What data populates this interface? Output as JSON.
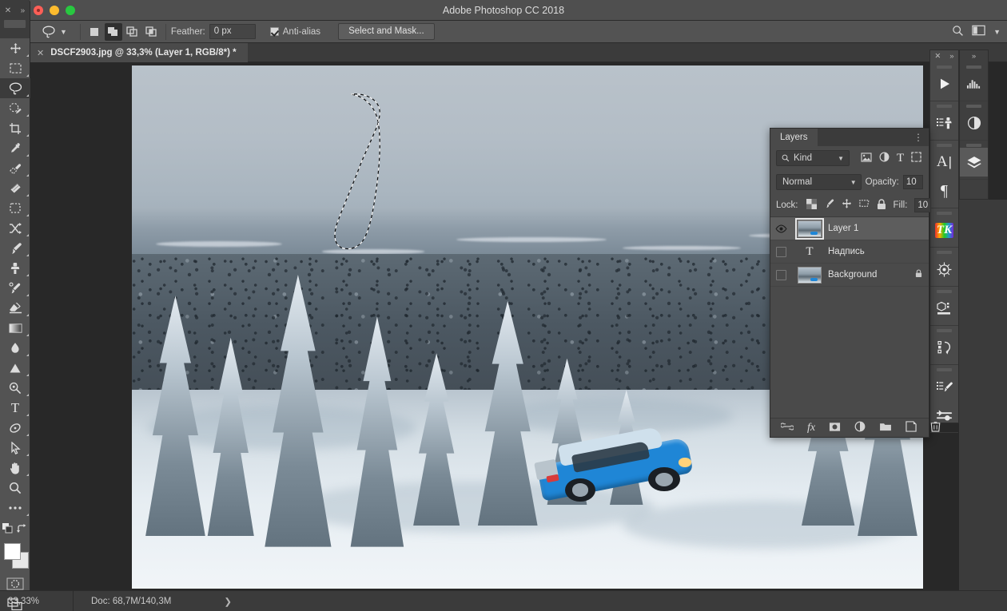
{
  "window": {
    "app_title": "Adobe Photoshop CC 2018",
    "traffic_lights": [
      "close-button",
      "minimize-button",
      "zoom-button"
    ]
  },
  "options_bar": {
    "active_tool_icon": "lasso-tool-icon",
    "tool_preset_chevron": "chevron-down-icon",
    "selection_modes": [
      {
        "name": "new-selection",
        "icon": "square-icon",
        "active": false
      },
      {
        "name": "add-to-selection",
        "icon": "two-squares-union-icon",
        "active": true
      },
      {
        "name": "subtract-from-selection",
        "icon": "two-squares-subtract-icon",
        "active": false
      },
      {
        "name": "intersect-with-selection",
        "icon": "two-squares-intersect-icon",
        "active": false
      }
    ],
    "feather_label": "Feather:",
    "feather_value": "0 px",
    "anti_alias_label": "Anti-alias",
    "anti_alias_checked": true,
    "select_and_mask_label": "Select and Mask...",
    "search_icon": "search-icon",
    "workspace_icon": "workspace-switcher-icon",
    "workspace_chevron": "chevron-down-icon"
  },
  "document_tab": {
    "close_icon": "close-icon",
    "title": "DSCF2903.jpg @ 33,3% (Layer 1, RGB/8*) *"
  },
  "toolbar": {
    "tools": [
      {
        "name": "move-tool",
        "icon": "move-icon",
        "has_flyout": true,
        "active": false
      },
      {
        "name": "rectangular-marquee-tool",
        "icon": "marquee-rect-icon",
        "has_flyout": true,
        "active": false
      },
      {
        "name": "lasso-tool",
        "icon": "lasso-icon",
        "has_flyout": true,
        "active": true
      },
      {
        "name": "quick-selection-tool",
        "icon": "quick-selection-icon",
        "has_flyout": true,
        "active": false
      },
      {
        "name": "crop-tool",
        "icon": "crop-icon",
        "has_flyout": true,
        "active": false
      },
      {
        "name": "eyedropper-tool",
        "icon": "eyedropper-icon",
        "has_flyout": true,
        "active": false
      },
      {
        "name": "spot-healing-brush-tool",
        "icon": "healing-brush-icon",
        "has_flyout": true,
        "active": false
      },
      {
        "name": "patch-tool",
        "icon": "patch-icon",
        "has_flyout": true,
        "active": false
      },
      {
        "name": "frame-tool",
        "icon": "frame-icon",
        "has_flyout": true,
        "active": false
      },
      {
        "name": "shuffle-tool",
        "icon": "shuffle-icon",
        "has_flyout": true,
        "active": false
      },
      {
        "name": "brush-tool",
        "icon": "brush-icon",
        "has_flyout": true,
        "active": false
      },
      {
        "name": "clone-stamp-tool",
        "icon": "clone-stamp-icon",
        "has_flyout": true,
        "active": false
      },
      {
        "name": "history-brush-tool",
        "icon": "history-brush-icon",
        "has_flyout": true,
        "active": false
      },
      {
        "name": "eraser-tool",
        "icon": "eraser-icon",
        "has_flyout": true,
        "active": false
      },
      {
        "name": "gradient-tool",
        "icon": "gradient-icon",
        "has_flyout": true,
        "active": false
      },
      {
        "name": "blur-tool",
        "icon": "blur-droplet-icon",
        "has_flyout": true,
        "active": false
      },
      {
        "name": "dodge-tool",
        "icon": "dodge-triangle-icon",
        "has_flyout": true,
        "active": false
      },
      {
        "name": "pen-tool",
        "icon": "pen-icon",
        "has_flyout": true,
        "active": false
      },
      {
        "name": "type-tool",
        "icon": "type-T-icon",
        "has_flyout": true,
        "active": false
      },
      {
        "name": "path-selection-tool",
        "icon": "path-selection-icon",
        "has_flyout": true,
        "active": false
      },
      {
        "name": "direct-selection-tool",
        "icon": "arrow-cursor-icon",
        "has_flyout": true,
        "active": false
      },
      {
        "name": "hand-tool",
        "icon": "hand-icon",
        "has_flyout": true,
        "active": false
      },
      {
        "name": "zoom-tool",
        "icon": "magnifier-icon",
        "has_flyout": false,
        "active": false
      },
      {
        "name": "edit-toolbar",
        "icon": "ellipsis-icon",
        "has_flyout": true,
        "active": false
      }
    ],
    "default_colors_icon": "default-colors-icon",
    "swap_colors_icon": "swap-colors-icon",
    "foreground_color": "#ffffff",
    "background_color": "#e8e8e8",
    "quick_mask_icon": "quick-mask-icon",
    "screen_mode_icon": "screen-mode-icon"
  },
  "mini_dock": {
    "close_icon": "close-icon",
    "expand_icon": "double-chevron-icon"
  },
  "layers_panel": {
    "tab_label": "Layers",
    "menu_icon": "panel-menu-icon",
    "filter": {
      "search_icon": "search-icon",
      "kind_label": "Kind",
      "chevron": "chevron-down-icon",
      "filter_icons": [
        {
          "name": "filter-pixel-layers-icon"
        },
        {
          "name": "filter-adjustment-layers-icon"
        },
        {
          "name": "filter-type-layers-icon"
        },
        {
          "name": "filter-shape-layers-icon"
        }
      ]
    },
    "blend_mode": "Normal",
    "blend_chevron": "chevron-down-icon",
    "opacity_label": "Opacity:",
    "opacity_value": "10",
    "lock_label": "Lock:",
    "lock_icons": [
      {
        "name": "lock-transparent-pixels-icon"
      },
      {
        "name": "lock-image-pixels-icon"
      },
      {
        "name": "lock-position-icon"
      },
      {
        "name": "lock-artboard-nesting-icon"
      },
      {
        "name": "lock-all-icon"
      }
    ],
    "fill_label": "Fill:",
    "fill_value": "10",
    "layers": [
      {
        "name": "Layer 1",
        "visible": true,
        "selected": true,
        "kind": "pixel",
        "locked": false
      },
      {
        "name": "Надпись",
        "visible": false,
        "selected": false,
        "kind": "type",
        "locked": false
      },
      {
        "name": "Background",
        "visible": false,
        "selected": false,
        "kind": "pixel",
        "locked": true
      }
    ],
    "bottom_buttons": [
      {
        "name": "link-layers-button",
        "icon": "link-icon"
      },
      {
        "name": "layer-style-button",
        "icon": "fx-icon"
      },
      {
        "name": "add-layer-mask-button",
        "icon": "layer-mask-icon"
      },
      {
        "name": "new-adjustment-layer-button",
        "icon": "adjustment-circle-icon"
      },
      {
        "name": "new-group-button",
        "icon": "folder-icon"
      },
      {
        "name": "new-layer-button",
        "icon": "new-layer-icon"
      },
      {
        "name": "delete-layer-button",
        "icon": "trash-icon"
      }
    ]
  },
  "icon_dock_primary": {
    "close_icon": "close-icon",
    "expand_icon": "double-chevron-icon",
    "items": [
      {
        "name": "actions-panel-icon",
        "glyph": "play-triangle-icon"
      },
      {
        "name": "tool-presets-panel-icon",
        "glyph": "stamp-list-icon"
      },
      {
        "name": "character-panel-icon",
        "glyph": "character-A-icon"
      },
      {
        "name": "paragraph-panel-icon",
        "glyph": "pilcrow-icon"
      },
      {
        "name": "tk-actions-panel-icon",
        "glyph": "tk-rainbow-icon"
      },
      {
        "name": "ship-wheel-panel-icon",
        "glyph": "ship-wheel-icon"
      },
      {
        "name": "3d-panel-icon",
        "glyph": "cube-list-icon"
      },
      {
        "name": "history-panel-icon",
        "glyph": "history-undo-icon"
      },
      {
        "name": "brush-presets-panel-icon",
        "glyph": "list-brush-icon"
      },
      {
        "name": "brush-settings-panel-icon",
        "glyph": "sliders-icon"
      }
    ]
  },
  "icon_dock_secondary": {
    "expand_icon": "double-chevron-icon",
    "items": [
      {
        "name": "histogram-panel-icon",
        "glyph": "histogram-icon",
        "active": false
      },
      {
        "name": "adjustments-panel-icon",
        "glyph": "half-circle-icon",
        "active": false
      },
      {
        "name": "layers-panel-icon",
        "glyph": "layers-stack-icon",
        "active": true
      }
    ]
  },
  "canvas": {
    "document_name": "DSCF2903.jpg",
    "zoom": "33,3%",
    "selection": "lasso-marching-ants-selection",
    "photo_description": "snowy-forest-landscape-with-blue-suv"
  },
  "status_bar": {
    "zoom_value": "33,33%",
    "doc_label": "Doc: 68,7M/140,3M",
    "expand_arrow": "chevron-right-icon"
  }
}
